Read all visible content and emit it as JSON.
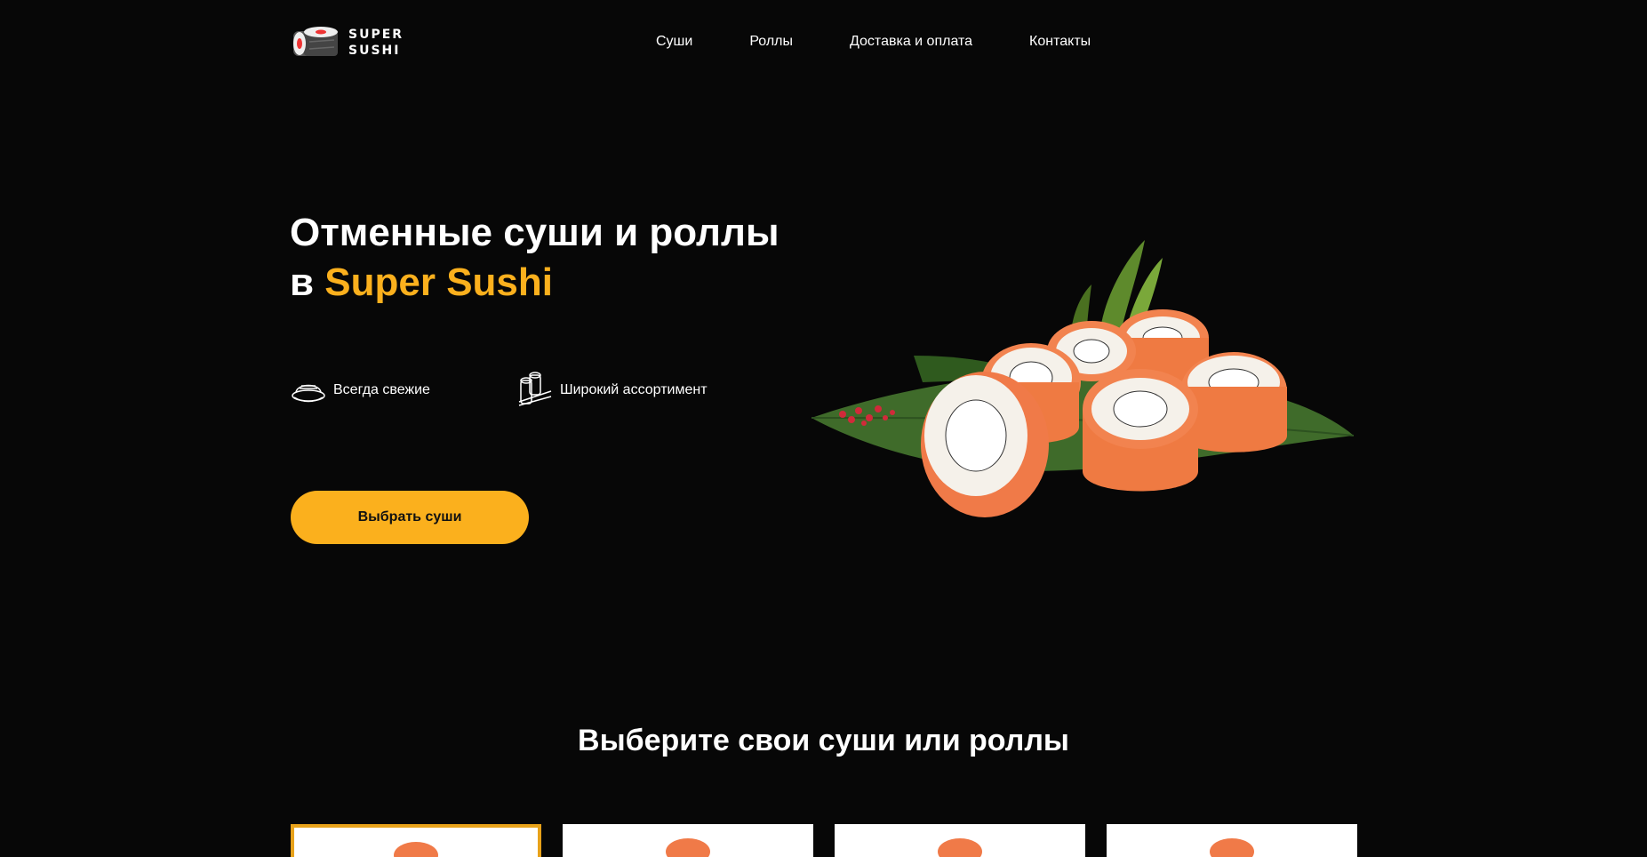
{
  "header": {
    "logo_line1": "SUPER",
    "logo_line2": "SUSHI",
    "nav": [
      "Суши",
      "Роллы",
      "Доставка и оплата",
      "Контакты"
    ]
  },
  "hero": {
    "title_line1": "Отменные суши и роллы",
    "title_prefix": "в ",
    "title_accent": "Super Sushi",
    "features": [
      {
        "icon": "sushi-plate-icon",
        "label": "Всегда свежие"
      },
      {
        "icon": "chopsticks-rolls-icon",
        "label": "Широкий ассортимент"
      }
    ],
    "cta_label": "Выбрать суши"
  },
  "section": {
    "title": "Выберите свои суши или роллы"
  },
  "colors": {
    "background": "#070707",
    "accent": "#fbb01d",
    "text": "#ffffff"
  }
}
